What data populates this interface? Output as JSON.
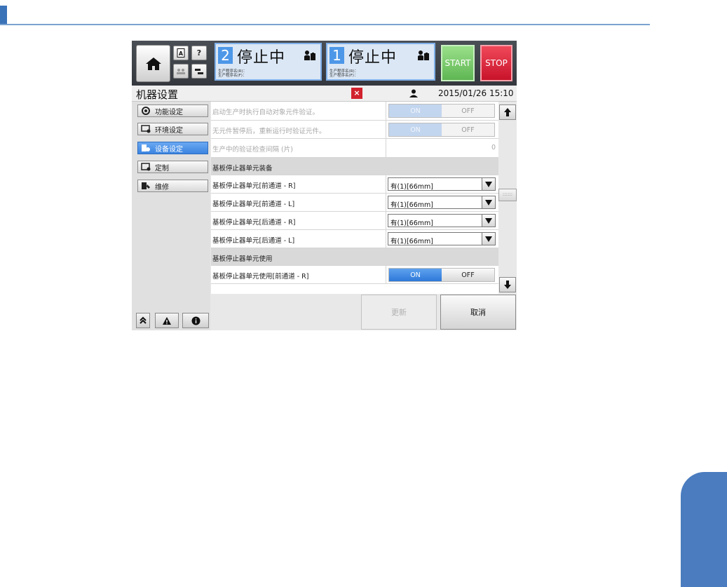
{
  "header": {
    "help_label": "?",
    "lanes": [
      {
        "number": "2",
        "status": "停止中",
        "prog_r": "生产程序名(R)：",
        "prog_f": "生产程序名(F)："
      },
      {
        "number": "1",
        "status": "停止中",
        "prog_r": "生产程序名(R)：",
        "prog_f": "生产程序名(F)："
      }
    ],
    "start_label": "START",
    "stop_label": "STOP"
  },
  "titlebar": {
    "title": "机器设置",
    "close_label": "×",
    "datetime": "2015/01/26 15:10"
  },
  "sidebar": {
    "items": [
      {
        "label": "功能设定",
        "icon": "gear-settings-icon",
        "active": false
      },
      {
        "label": "环境设定",
        "icon": "monitor-settings-icon",
        "active": false
      },
      {
        "label": "设备设定",
        "icon": "device-settings-icon",
        "active": true
      },
      {
        "label": "定制",
        "icon": "customize-icon",
        "active": false
      },
      {
        "label": "维修",
        "icon": "maintenance-icon",
        "active": false
      }
    ],
    "bottom_icons": [
      "double-chevron-up-icon",
      "warning-icon",
      "info-icon"
    ]
  },
  "settings": {
    "rows": [
      {
        "label": "启动生产时执行自动对象元件验证。",
        "type": "toggle",
        "on": "ON",
        "off": "OFF",
        "enabled": false
      },
      {
        "label": "无元件暂停后，重新运行时验证元件。",
        "type": "toggle",
        "on": "ON",
        "off": "OFF",
        "enabled": false
      },
      {
        "label": "生产中的验证检查间隔 (片)",
        "type": "number",
        "value": "0",
        "enabled": false
      },
      {
        "label": "基板停止器单元装备",
        "type": "section"
      },
      {
        "label": "基板停止器单元[前通道 - R]",
        "type": "select",
        "value": "有(1)[66mm]"
      },
      {
        "label": "基板停止器单元[前通道 - L]",
        "type": "select",
        "value": "有(1)[66mm]"
      },
      {
        "label": "基板停止器单元[后通道 - R]",
        "type": "select",
        "value": "有(1)[66mm]"
      },
      {
        "label": "基板停止器单元[后通道 - L]",
        "type": "select",
        "value": "有(1)[66mm]"
      },
      {
        "label": "基板停止器单元使用",
        "type": "section"
      },
      {
        "label": "基板停止器单元使用[前通道 - R]",
        "type": "toggle",
        "on": "ON",
        "off": "OFF",
        "enabled": true
      }
    ]
  },
  "scrollbar": {
    "grip": "::::::"
  },
  "footer": {
    "update_label": "更新",
    "cancel_label": "取消"
  },
  "colors": {
    "accent_blue": "#3b84e0",
    "start_green": "#5fb653",
    "stop_red": "#c8132a"
  }
}
